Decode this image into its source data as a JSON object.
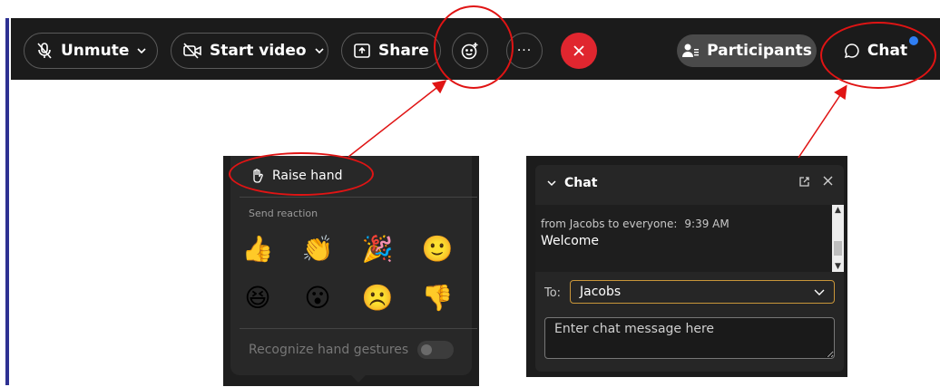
{
  "toolbar": {
    "unmute_label": "Unmute",
    "start_video_label": "Start video",
    "share_label": "Share",
    "more_label": "···",
    "participants_label": "Participants",
    "chat_label": "Chat"
  },
  "reactions_panel": {
    "raise_hand_label": "Raise hand",
    "send_reaction_label": "Send reaction",
    "emojis": [
      "👍",
      "👏",
      "🎉",
      "🙂",
      "😆",
      "😮",
      "☹️",
      "👎"
    ],
    "recognize_gestures_label": "Recognize hand gestures"
  },
  "chat_panel": {
    "title": "Chat",
    "message": {
      "from": "from Jacobs to everyone:",
      "time": "9:39 AM",
      "text": "Welcome"
    },
    "to_label": "To:",
    "to_value": "Jacobs",
    "input_placeholder": "Enter chat message here"
  },
  "colors": {
    "toolbar_bg": "#1b1b1b",
    "end_call": "#e0262f",
    "highlight_ring": "#e01414",
    "notify_dot": "#2f7ef3",
    "to_select_border": "#c9963a"
  }
}
